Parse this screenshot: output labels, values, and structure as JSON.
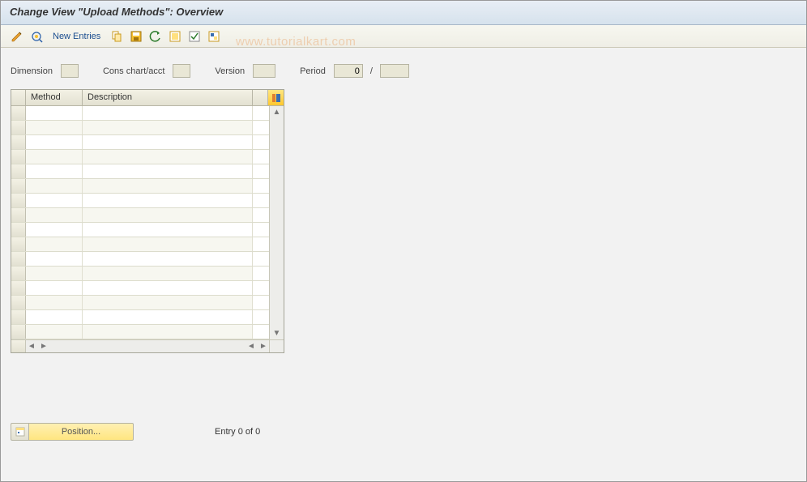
{
  "title": "Change View \"Upload Methods\": Overview",
  "toolbar": {
    "new_entries_label": "New Entries"
  },
  "params": {
    "dimension_label": "Dimension",
    "dimension_value": "",
    "cons_label": "Cons chart/acct",
    "cons_value": "",
    "version_label": "Version",
    "version_value": "",
    "period_label": "Period",
    "period_value": "0",
    "period_sep": "/",
    "period_year_value": ""
  },
  "table": {
    "col_method": "Method",
    "col_description": "Description",
    "row_count": 16
  },
  "footer": {
    "position_label": "Position...",
    "entry_text": "Entry 0 of 0"
  },
  "watermark": "www.tutorialkart.com"
}
